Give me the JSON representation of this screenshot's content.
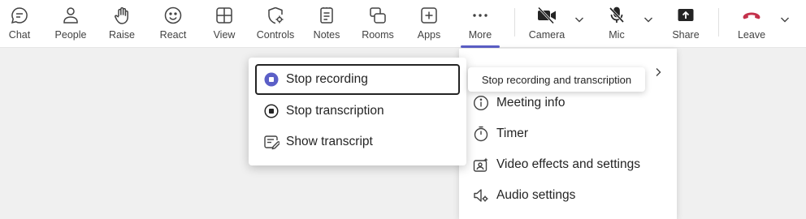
{
  "toolbar": {
    "buttons": [
      {
        "label": "Chat",
        "icon": "chat-icon"
      },
      {
        "label": "People",
        "icon": "people-icon"
      },
      {
        "label": "Raise",
        "icon": "raise-hand-icon"
      },
      {
        "label": "React",
        "icon": "react-smiley-icon"
      },
      {
        "label": "View",
        "icon": "view-grid-icon"
      },
      {
        "label": "Controls",
        "icon": "controls-shield-icon"
      },
      {
        "label": "Notes",
        "icon": "notes-icon"
      },
      {
        "label": "Rooms",
        "icon": "rooms-icon"
      },
      {
        "label": "Apps",
        "icon": "apps-plus-icon"
      },
      {
        "label": "More",
        "icon": "more-icon"
      },
      {
        "label": "Camera",
        "icon": "camera-off-icon"
      },
      {
        "label": "Mic",
        "icon": "mic-off-icon"
      },
      {
        "label": "Share",
        "icon": "share-icon"
      },
      {
        "label": "Leave",
        "icon": "leave-phone-icon"
      }
    ],
    "active": "More",
    "leave_color": "#c4314b",
    "active_color": "#5b5fc7"
  },
  "more_menu": {
    "items": [
      {
        "label": "Meeting info",
        "icon": "info-icon"
      },
      {
        "label": "Timer",
        "icon": "timer-icon"
      },
      {
        "label": "Video effects and settings",
        "icon": "video-effects-icon"
      },
      {
        "label": "Audio settings",
        "icon": "audio-settings-icon"
      }
    ]
  },
  "record_submenu": {
    "items": [
      {
        "label": "Stop recording",
        "icon": "stop-recording-icon"
      },
      {
        "label": "Stop transcription",
        "icon": "stop-transcription-icon"
      },
      {
        "label": "Show transcript",
        "icon": "transcript-icon"
      }
    ]
  },
  "tooltip": {
    "text": "Stop recording and transcription"
  }
}
